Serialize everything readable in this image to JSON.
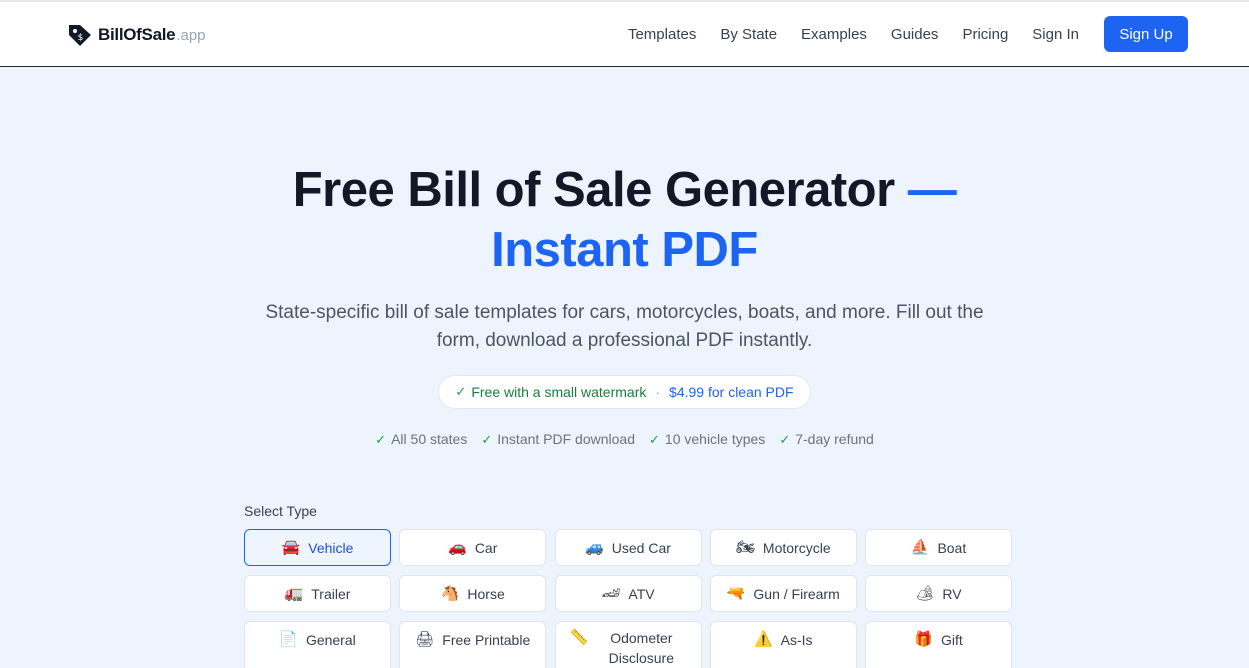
{
  "header": {
    "logo_name": "BillOfSale",
    "logo_suffix": ".app",
    "nav": [
      "Templates",
      "By State",
      "Examples",
      "Guides",
      "Pricing",
      "Sign In"
    ],
    "signup_label": "Sign Up"
  },
  "hero": {
    "title_main": "Free Bill of Sale Generator",
    "title_dash": "—",
    "title_accent": "Instant PDF",
    "subtitle": "State-specific bill of sale templates for cars, motorcycles, boats, and more. Fill out the form, download a professional PDF instantly.",
    "pill_free": "Free with a small watermark",
    "pill_dot": "·",
    "pill_price": "$4.99 for clean PDF",
    "features": [
      "All 50 states",
      "Instant PDF download",
      "10 vehicle types",
      "7-day refund"
    ]
  },
  "select": {
    "label": "Select Type",
    "types": [
      {
        "emoji": "🚘",
        "label": "Vehicle"
      },
      {
        "emoji": "🚗",
        "label": "Car"
      },
      {
        "emoji": "🚙",
        "label": "Used Car"
      },
      {
        "emoji": "🏍",
        "label": "Motorcycle"
      },
      {
        "emoji": "⛵",
        "label": "Boat"
      },
      {
        "emoji": "🚛",
        "label": "Trailer"
      },
      {
        "emoji": "🐴",
        "label": "Horse"
      },
      {
        "emoji": "🏎",
        "label": "ATV"
      },
      {
        "emoji": "🔫",
        "label": "Gun / Firearm"
      },
      {
        "emoji": "🏕",
        "label": "RV"
      },
      {
        "emoji": "📄",
        "label": "General"
      },
      {
        "emoji": "🖨",
        "label": "Free Printable"
      },
      {
        "emoji": "📏",
        "label": "Odometer Disclosure"
      },
      {
        "emoji": "⚠️",
        "label": "As-Is"
      },
      {
        "emoji": "🎁",
        "label": "Gift"
      }
    ],
    "selected": "Vehicle"
  },
  "colors": {
    "accent": "#1d64f2",
    "background": "#eef4fd",
    "success": "#16a34a"
  }
}
